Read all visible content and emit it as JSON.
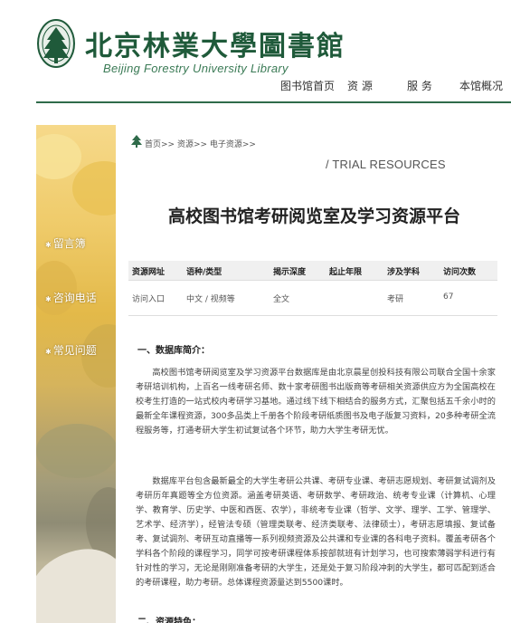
{
  "header": {
    "logo_cn": "北京林業大學圖書館",
    "logo_en": "Beijing Forestry University Library",
    "nav": [
      {
        "label": "图书馆首页"
      },
      {
        "label": "资  源"
      },
      {
        "label": "服  务"
      },
      {
        "label": "本馆概况"
      }
    ]
  },
  "sidebar": {
    "links": [
      {
        "label": "留言簿"
      },
      {
        "label": "咨询电话"
      },
      {
        "label": "常见问题"
      }
    ]
  },
  "breadcrumb": {
    "text": "首页>>  资源>>  电子资源>>"
  },
  "trial_label": "/ TRIAL RESOURCES",
  "page_title": "高校图书馆考研阅览室及学习资源平台",
  "info_table": {
    "headers": [
      "资源网址",
      "语种/类型",
      "揭示深度",
      "起止年限",
      "涉及学科",
      "访问次数"
    ],
    "row": [
      "访问入口",
      "中文 / 视频等",
      "全文",
      "",
      "考研",
      "67"
    ]
  },
  "section1": {
    "title": "一、数据库简介：",
    "para1": "高校图书馆考研阅览室及学习资源平台数据库是由北京晨星创投科技有限公司联合全国十余家考研培训机构，上百名一线考研名师、数十家考研图书出版商等考研相关资源供应方为全国高校在校考生打造的一站式校内考研学习基地。通过线下线下相结合的服务方式，汇聚包括五千余小时的最新全年课程资源，300多品类上千册各个阶段考研纸质图书及电子版复习资料，20多种考研全流程服务等，打通考研大学生初试复试各个环节，助力大学生考研无忧。",
    "para2": "数据库平台包含最新最全的大学生考研公共课、考研专业课、考研志愿规划、考研复试调剂及考研历年真题等全方位资源。涵盖考研英语、考研数学、考研政治、统考专业课（计算机、心理学、教育学、历史学、中医和西医、农学），非统考专业课（哲学、文学、理学、工学、管理学、艺术学、经济学），经管法专硕（管理类联考、经济类联考、法律硕士），考研志愿填报、复试备考、复试调剂、考研互动直播等一系列视频资源及公共课和专业课的各科电子资料。覆盖考研各个学科各个阶段的课程学习，同学可按考研课程体系按部就班有计划学习，也可搜索薄弱学科进行有针对性的学习，无论是刚刚准备考研的大学生，还是处于复习阶段冲刺的大学生，都可匹配到适合的考研课程，助力考研。总体课程资源量达到5500课时。"
  },
  "section2": {
    "title": "二、资源特色："
  },
  "colors": {
    "brand_green": "#1f5a3a",
    "nav_bar": "#2f6b4a"
  }
}
